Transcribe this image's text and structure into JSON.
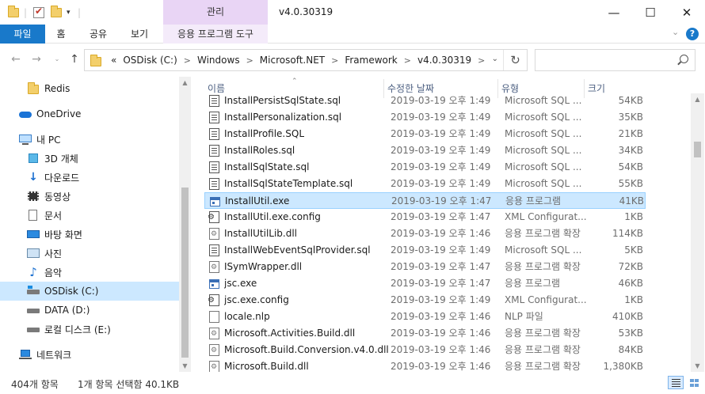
{
  "window": {
    "title": "v4.0.30319",
    "context_tab": "관리",
    "minimize": "—",
    "maximize": "☐",
    "close": "✕"
  },
  "ribbon": {
    "tabs": [
      "파일",
      "홈",
      "공유",
      "보기"
    ],
    "context_tool": "응용 프로그램 도구",
    "expand": "⌄",
    "help": "?"
  },
  "address": {
    "crumbs": [
      "OSDisk (C:)",
      "Windows",
      "Microsoft.NET",
      "Framework",
      "v4.0.30319"
    ],
    "overflow": "«",
    "separator": ">",
    "search_placeholder": ""
  },
  "nav": {
    "items": [
      {
        "label": "Redis",
        "icon": "folder-icon"
      },
      {
        "label": "OneDrive",
        "icon": "cloud-icon"
      },
      {
        "label": "내 PC",
        "icon": "computer-icon"
      },
      {
        "label": "3D 개체",
        "icon": "cube-icon"
      },
      {
        "label": "다운로드",
        "icon": "download-icon"
      },
      {
        "label": "동영상",
        "icon": "video-icon"
      },
      {
        "label": "문서",
        "icon": "document-icon"
      },
      {
        "label": "바탕 화면",
        "icon": "desktop-icon"
      },
      {
        "label": "사진",
        "icon": "picture-icon"
      },
      {
        "label": "음악",
        "icon": "music-icon"
      },
      {
        "label": "OSDisk (C:)",
        "icon": "drive-icon"
      },
      {
        "label": "DATA (D:)",
        "icon": "drive-icon"
      },
      {
        "label": "로컬 디스크 (E:)",
        "icon": "drive-icon"
      },
      {
        "label": "네트워크",
        "icon": "network-icon"
      }
    ],
    "selected": "OSDisk (C:)"
  },
  "list": {
    "columns": [
      "이름",
      "수정한 날짜",
      "유형",
      "크기"
    ],
    "rows": [
      {
        "name": "InstallPersistSqlState.sql",
        "date": "2019-03-19 오후 1:49",
        "type": "Microsoft SQL ...",
        "size": "54KB",
        "icon": "sql"
      },
      {
        "name": "InstallPersonalization.sql",
        "date": "2019-03-19 오후 1:49",
        "type": "Microsoft SQL ...",
        "size": "35KB",
        "icon": "sql"
      },
      {
        "name": "InstallProfile.SQL",
        "date": "2019-03-19 오후 1:49",
        "type": "Microsoft SQL ...",
        "size": "21KB",
        "icon": "sql"
      },
      {
        "name": "InstallRoles.sql",
        "date": "2019-03-19 오후 1:49",
        "type": "Microsoft SQL ...",
        "size": "34KB",
        "icon": "sql"
      },
      {
        "name": "InstallSqlState.sql",
        "date": "2019-03-19 오후 1:49",
        "type": "Microsoft SQL ...",
        "size": "54KB",
        "icon": "sql"
      },
      {
        "name": "InstallSqlStateTemplate.sql",
        "date": "2019-03-19 오후 1:49",
        "type": "Microsoft SQL ...",
        "size": "55KB",
        "icon": "sql"
      },
      {
        "name": "InstallUtil.exe",
        "date": "2019-03-19 오후 1:47",
        "type": "응용 프로그램",
        "size": "41KB",
        "icon": "exe",
        "selected": true
      },
      {
        "name": "InstallUtil.exe.config",
        "date": "2019-03-19 오후 1:47",
        "type": "XML Configurat...",
        "size": "1KB",
        "icon": "cfg"
      },
      {
        "name": "InstallUtilLib.dll",
        "date": "2019-03-19 오후 1:46",
        "type": "응용 프로그램 확장",
        "size": "114KB",
        "icon": "dll"
      },
      {
        "name": "InstallWebEventSqlProvider.sql",
        "date": "2019-03-19 오후 1:49",
        "type": "Microsoft SQL ...",
        "size": "5KB",
        "icon": "sql"
      },
      {
        "name": "ISymWrapper.dll",
        "date": "2019-03-19 오후 1:47",
        "type": "응용 프로그램 확장",
        "size": "72KB",
        "icon": "dll"
      },
      {
        "name": "jsc.exe",
        "date": "2019-03-19 오후 1:47",
        "type": "응용 프로그램",
        "size": "46KB",
        "icon": "exe"
      },
      {
        "name": "jsc.exe.config",
        "date": "2019-03-19 오후 1:49",
        "type": "XML Configurat...",
        "size": "1KB",
        "icon": "cfg"
      },
      {
        "name": "locale.nlp",
        "date": "2019-03-19 오후 1:46",
        "type": "NLP 파일",
        "size": "410KB",
        "icon": "nlp"
      },
      {
        "name": "Microsoft.Activities.Build.dll",
        "date": "2019-03-19 오후 1:46",
        "type": "응용 프로그램 확장",
        "size": "53KB",
        "icon": "dll"
      },
      {
        "name": "Microsoft.Build.Conversion.v4.0.dll",
        "date": "2019-03-19 오후 1:46",
        "type": "응용 프로그램 확장",
        "size": "84KB",
        "icon": "dll"
      },
      {
        "name": "Microsoft.Build.dll",
        "date": "2019-03-19 오후 1:46",
        "type": "응용 프로그램 확장",
        "size": "1,380KB",
        "icon": "dll"
      }
    ]
  },
  "status": {
    "count": "404개 항목",
    "selection": "1개 항목 선택함 40.1KB"
  }
}
